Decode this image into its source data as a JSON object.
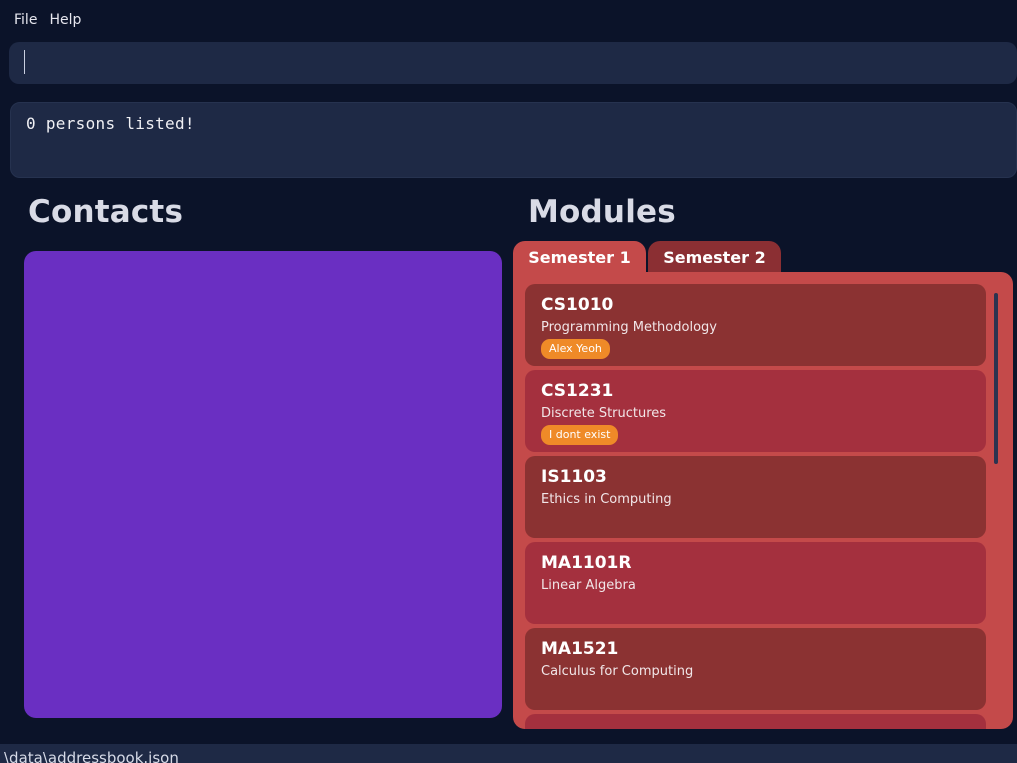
{
  "menu": {
    "file": "File",
    "help": "Help"
  },
  "command": {
    "value": "",
    "placeholder": ""
  },
  "result": {
    "text": "0 persons listed!"
  },
  "contacts": {
    "title": "Contacts"
  },
  "modules": {
    "title": "Modules",
    "tabs": [
      {
        "label": "Semester 1",
        "selected": true
      },
      {
        "label": "Semester 2",
        "selected": false
      }
    ],
    "items": [
      {
        "code": "CS1010",
        "name": "Programming Methodology",
        "tag": "Alex Yeoh"
      },
      {
        "code": "CS1231",
        "name": "Discrete Structures",
        "tag": "I dont exist"
      },
      {
        "code": "IS1103",
        "name": "Ethics in Computing",
        "tag": ""
      },
      {
        "code": "MA1101R",
        "name": "Linear Algebra",
        "tag": ""
      },
      {
        "code": "MA1521",
        "name": "Calculus for Computing",
        "tag": ""
      }
    ]
  },
  "status_bar": {
    "path": "\\data\\addressbook.json"
  },
  "colors": {
    "background": "#0b1329",
    "panel": "#1e2945",
    "contacts_panel": "#6a2fc2",
    "modules_panel": "#c44a4a",
    "card_dark": "#8b3232",
    "card_light": "#a4303e",
    "tag": "#ef8a28"
  }
}
